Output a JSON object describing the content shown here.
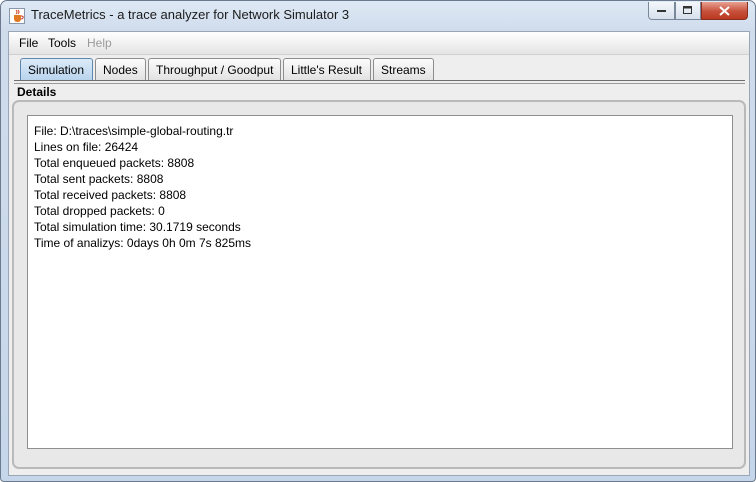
{
  "window": {
    "title": "TraceMetrics - a trace analyzer for Network Simulator 3"
  },
  "menu": {
    "file": "File",
    "tools": "Tools",
    "help": "Help"
  },
  "tabs": [
    {
      "label": "Simulation",
      "active": true
    },
    {
      "label": "Nodes",
      "active": false
    },
    {
      "label": "Throughput / Goodput",
      "active": false
    },
    {
      "label": "Little's Result",
      "active": false
    },
    {
      "label": "Streams",
      "active": false
    }
  ],
  "details": {
    "label": "Details",
    "lines": [
      "File: D:\\traces\\simple-global-routing.tr",
      "Lines on file: 26424",
      "Total enqueued packets: 8808",
      "Total sent packets: 8808",
      "Total received packets: 8808",
      "Total dropped packets: 0",
      "Total simulation time: 30.1719 seconds",
      "Time of analizys: 0days 0h 0m 7s 825ms"
    ]
  },
  "colors": {
    "active_tab": "#b9d4ee",
    "close_button": "#c7503b"
  }
}
